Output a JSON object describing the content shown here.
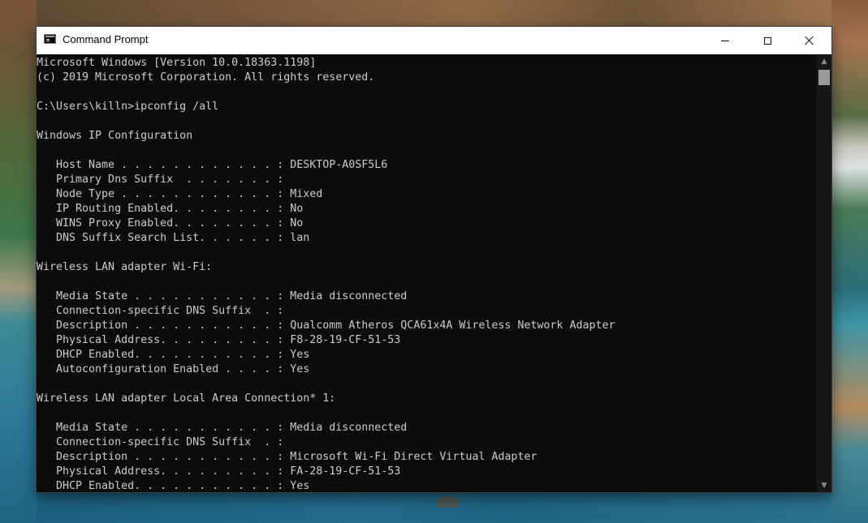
{
  "window": {
    "title": "Command Prompt"
  },
  "console": {
    "lines": [
      "Microsoft Windows [Version 10.0.18363.1198]",
      "(c) 2019 Microsoft Corporation. All rights reserved.",
      "",
      "C:\\Users\\killn>ipconfig /all",
      "",
      "Windows IP Configuration",
      "",
      "   Host Name . . . . . . . . . . . . : DESKTOP-A0SF5L6",
      "   Primary Dns Suffix  . . . . . . . : ",
      "   Node Type . . . . . . . . . . . . : Mixed",
      "   IP Routing Enabled. . . . . . . . : No",
      "   WINS Proxy Enabled. . . . . . . . : No",
      "   DNS Suffix Search List. . . . . . : lan",
      "",
      "Wireless LAN adapter Wi-Fi:",
      "",
      "   Media State . . . . . . . . . . . : Media disconnected",
      "   Connection-specific DNS Suffix  . : ",
      "   Description . . . . . . . . . . . : Qualcomm Atheros QCA61x4A Wireless Network Adapter",
      "   Physical Address. . . . . . . . . : F8-28-19-CF-51-53",
      "   DHCP Enabled. . . . . . . . . . . : Yes",
      "   Autoconfiguration Enabled . . . . : Yes",
      "",
      "Wireless LAN adapter Local Area Connection* 1:",
      "",
      "   Media State . . . . . . . . . . . : Media disconnected",
      "   Connection-specific DNS Suffix  . : ",
      "   Description . . . . . . . . . . . : Microsoft Wi-Fi Direct Virtual Adapter",
      "   Physical Address. . . . . . . . . : FA-28-19-CF-51-53",
      "   DHCP Enabled. . . . . . . . . . . : Yes"
    ]
  },
  "icons": {
    "app": "command-prompt-icon",
    "minimize": "minimize-icon",
    "maximize": "maximize-icon",
    "close": "close-icon",
    "scroll_up": "chevron-up-icon",
    "scroll_down": "chevron-down-icon"
  },
  "colors": {
    "console_background": "#0c0c0c",
    "console_text": "#cccccc",
    "titlebar_background": "#ffffff"
  }
}
